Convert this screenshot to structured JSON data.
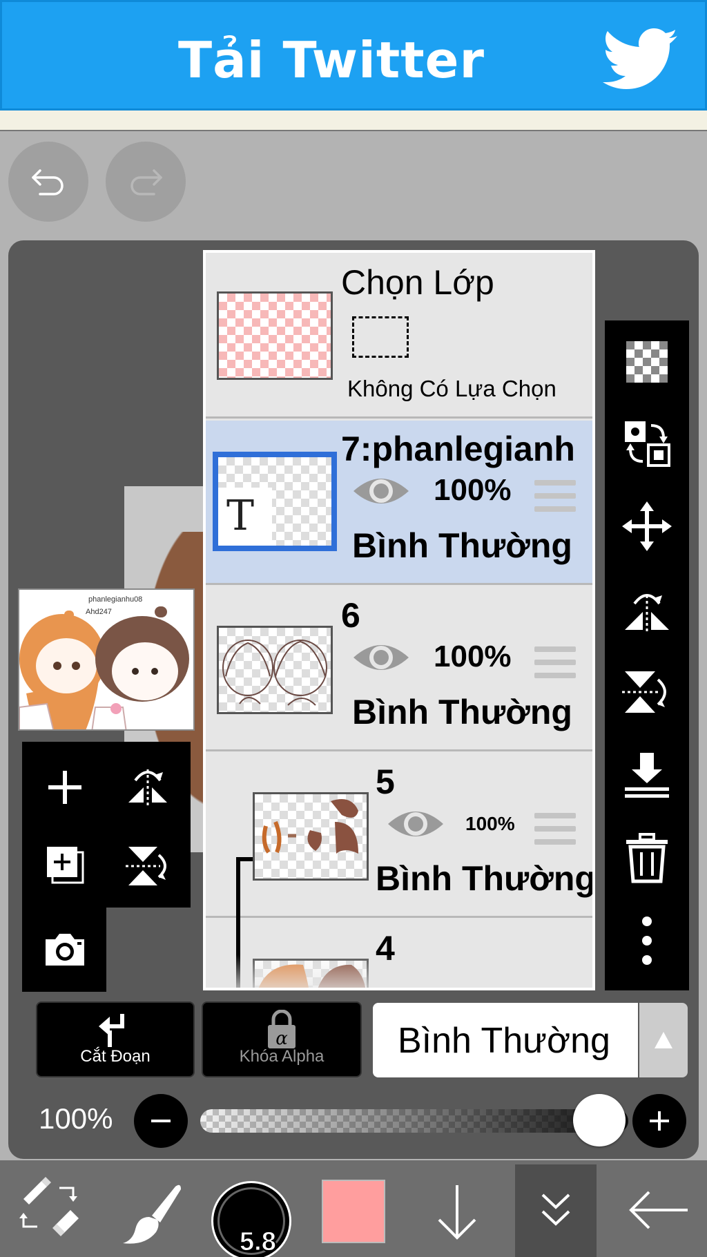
{
  "ad": {
    "title": "Tải Twitter"
  },
  "history": {
    "undo": "undo-icon",
    "redo": "redo-icon"
  },
  "thumbnail": {
    "line1": "phanlegianhu08",
    "line2": "Ahd247"
  },
  "layer_panel": {
    "selection": {
      "title": "Chọn Lớp",
      "subtitle": "Không Có Lựa Chọn"
    },
    "layers": [
      {
        "name": "7:phanlegianh",
        "opacity": "100%",
        "blend": "Bình Thường",
        "selected": true,
        "type": "text",
        "thumb_text": "T"
      },
      {
        "name": "6",
        "opacity": "100%",
        "blend": "Bình Thường",
        "selected": false
      },
      {
        "name": "5",
        "opacity": "100%",
        "blend": "Bình Thường",
        "selected": false
      },
      {
        "name": "4",
        "opacity": "",
        "blend": "",
        "selected": false
      }
    ]
  },
  "controls": {
    "cut_label": "Cắt Đoạn",
    "alpha_label": "Khóa Alpha",
    "blend_mode": "Bình Thường",
    "opacity_label": "100%",
    "opacity_value": 1.0
  },
  "bottom_bar": {
    "brush_size": "5.8",
    "color": "#ff9e9e"
  },
  "colors": {
    "ad_blue": "#1da1f2",
    "selected_layer": "#cad8ee",
    "selected_border": "#2f6fd8"
  }
}
